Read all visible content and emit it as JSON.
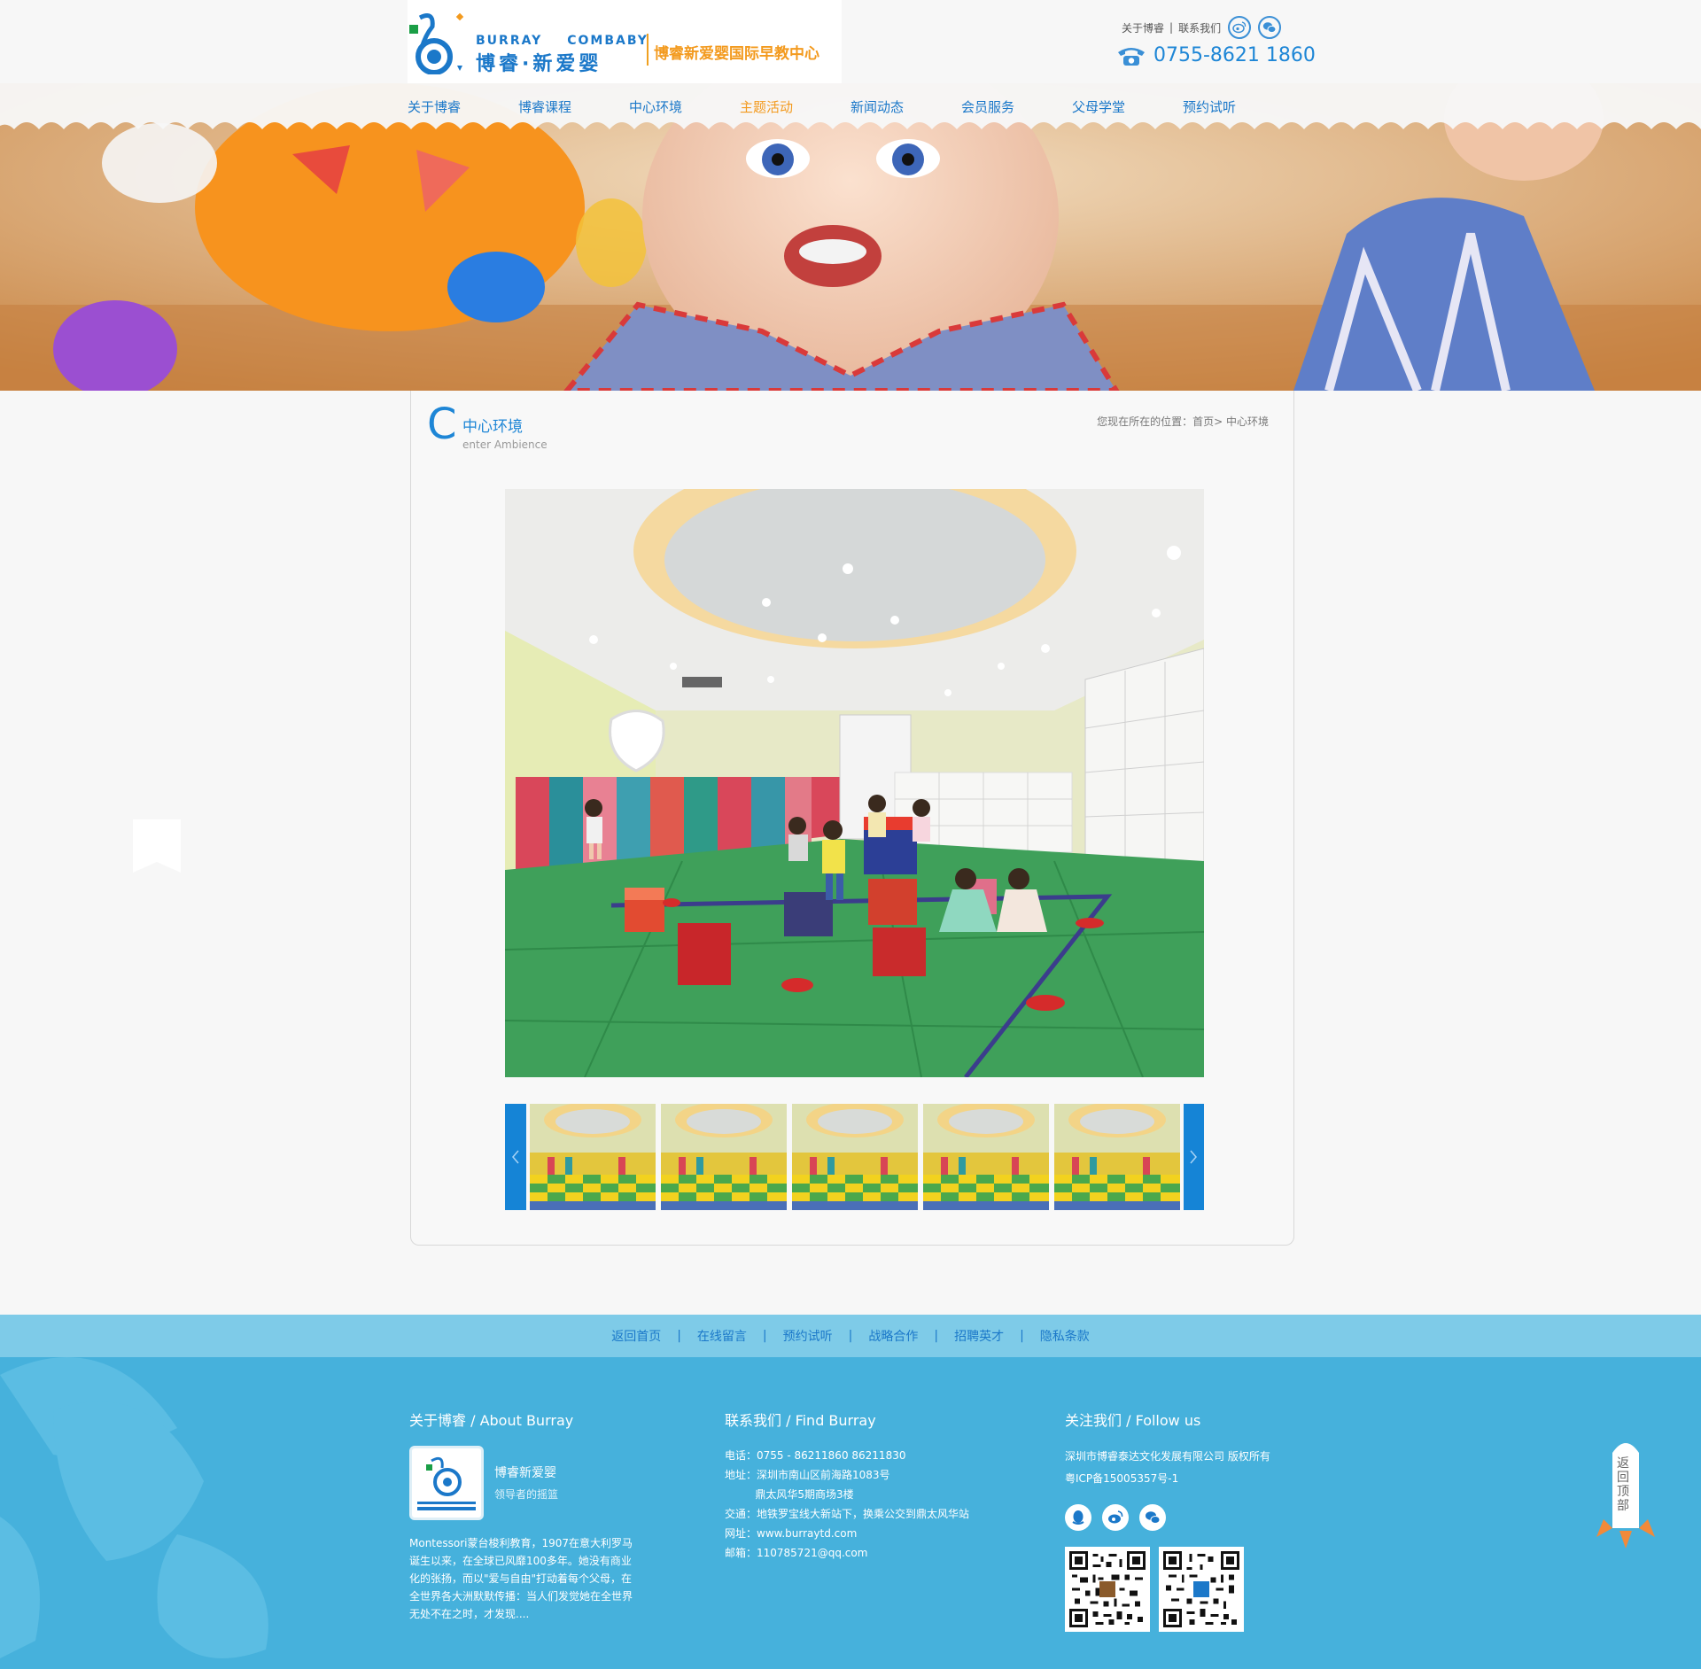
{
  "header": {
    "logo": {
      "en_left": "BURRAY",
      "en_right": "COMBABY",
      "cn": "博睿·新爱婴",
      "tagline": "博睿新爱婴国际早教中心"
    },
    "top_links": [
      {
        "label": "关于博睿"
      },
      {
        "label": "联系我们"
      }
    ],
    "separator": "|",
    "icons": [
      "weibo-icon",
      "wechat-icon",
      "phone-icon"
    ],
    "phone": "0755-8621 1860"
  },
  "nav": {
    "items": [
      {
        "label": "关于博睿"
      },
      {
        "label": "博睿课程"
      },
      {
        "label": "中心环境"
      },
      {
        "label": "主题活动",
        "active": true
      },
      {
        "label": "新闻动态"
      },
      {
        "label": "会员服务"
      },
      {
        "label": "父母学堂"
      },
      {
        "label": "预约试听"
      }
    ],
    "active_color": "#f39a1e",
    "color": "#1b78c9"
  },
  "section": {
    "letter": "C",
    "title_cn": "中心环境",
    "title_en": "enter Ambience",
    "breadcrumb": "您现在所在的位置：首页> 中心环境"
  },
  "gallery": {
    "thumb_count": 5,
    "prev_icon": "chevron-left-icon",
    "next_icon": "chevron-right-icon"
  },
  "footer_links": {
    "items": [
      "返回首页",
      "在线留言",
      "预约试听",
      "战略合作",
      "招聘英才",
      "隐私条款"
    ],
    "separator": "|"
  },
  "footer": {
    "about": {
      "heading": "关于博睿 / About Burray",
      "name": "博睿新爱婴",
      "slogan": "领导者的摇篮",
      "text": "Montessori蒙台梭利教育，1907在意大利罗马诞生以来，在全球已风靡100多年。她没有商业化的张扬，而以\"爱与自由\"打动着每个父母，在全世界各大洲默默传播：当人们发觉她在全世界无处不在之时，才发现...."
    },
    "contact": {
      "heading": "联系我们 / Find Burray",
      "lines": [
        "电话：0755 - 86211860  86211830",
        "地址：深圳市南山区前海路1083号",
        "         鼎太风华5期商场3楼",
        "交通：地铁罗宝线大新站下，换乘公交到鼎太风华站",
        "网址：www.burraytd.com",
        "邮箱：110785721@qq.com"
      ]
    },
    "follow": {
      "heading": "关注我们 / Follow us",
      "lines": [
        "深圳市博睿泰达文化发展有限公司 版权所有",
        "粤ICP备15005357号-1"
      ],
      "icons": [
        "qq-icon",
        "weibo-icon",
        "wechat-icon"
      ]
    }
  },
  "back_to_top": {
    "label": "返回顶部"
  },
  "colors": {
    "brand_blue": "#1b78c9",
    "accent_orange": "#f39a1e",
    "footer_bg": "#46b1dc",
    "footer_bar": "#7ecbe8"
  }
}
